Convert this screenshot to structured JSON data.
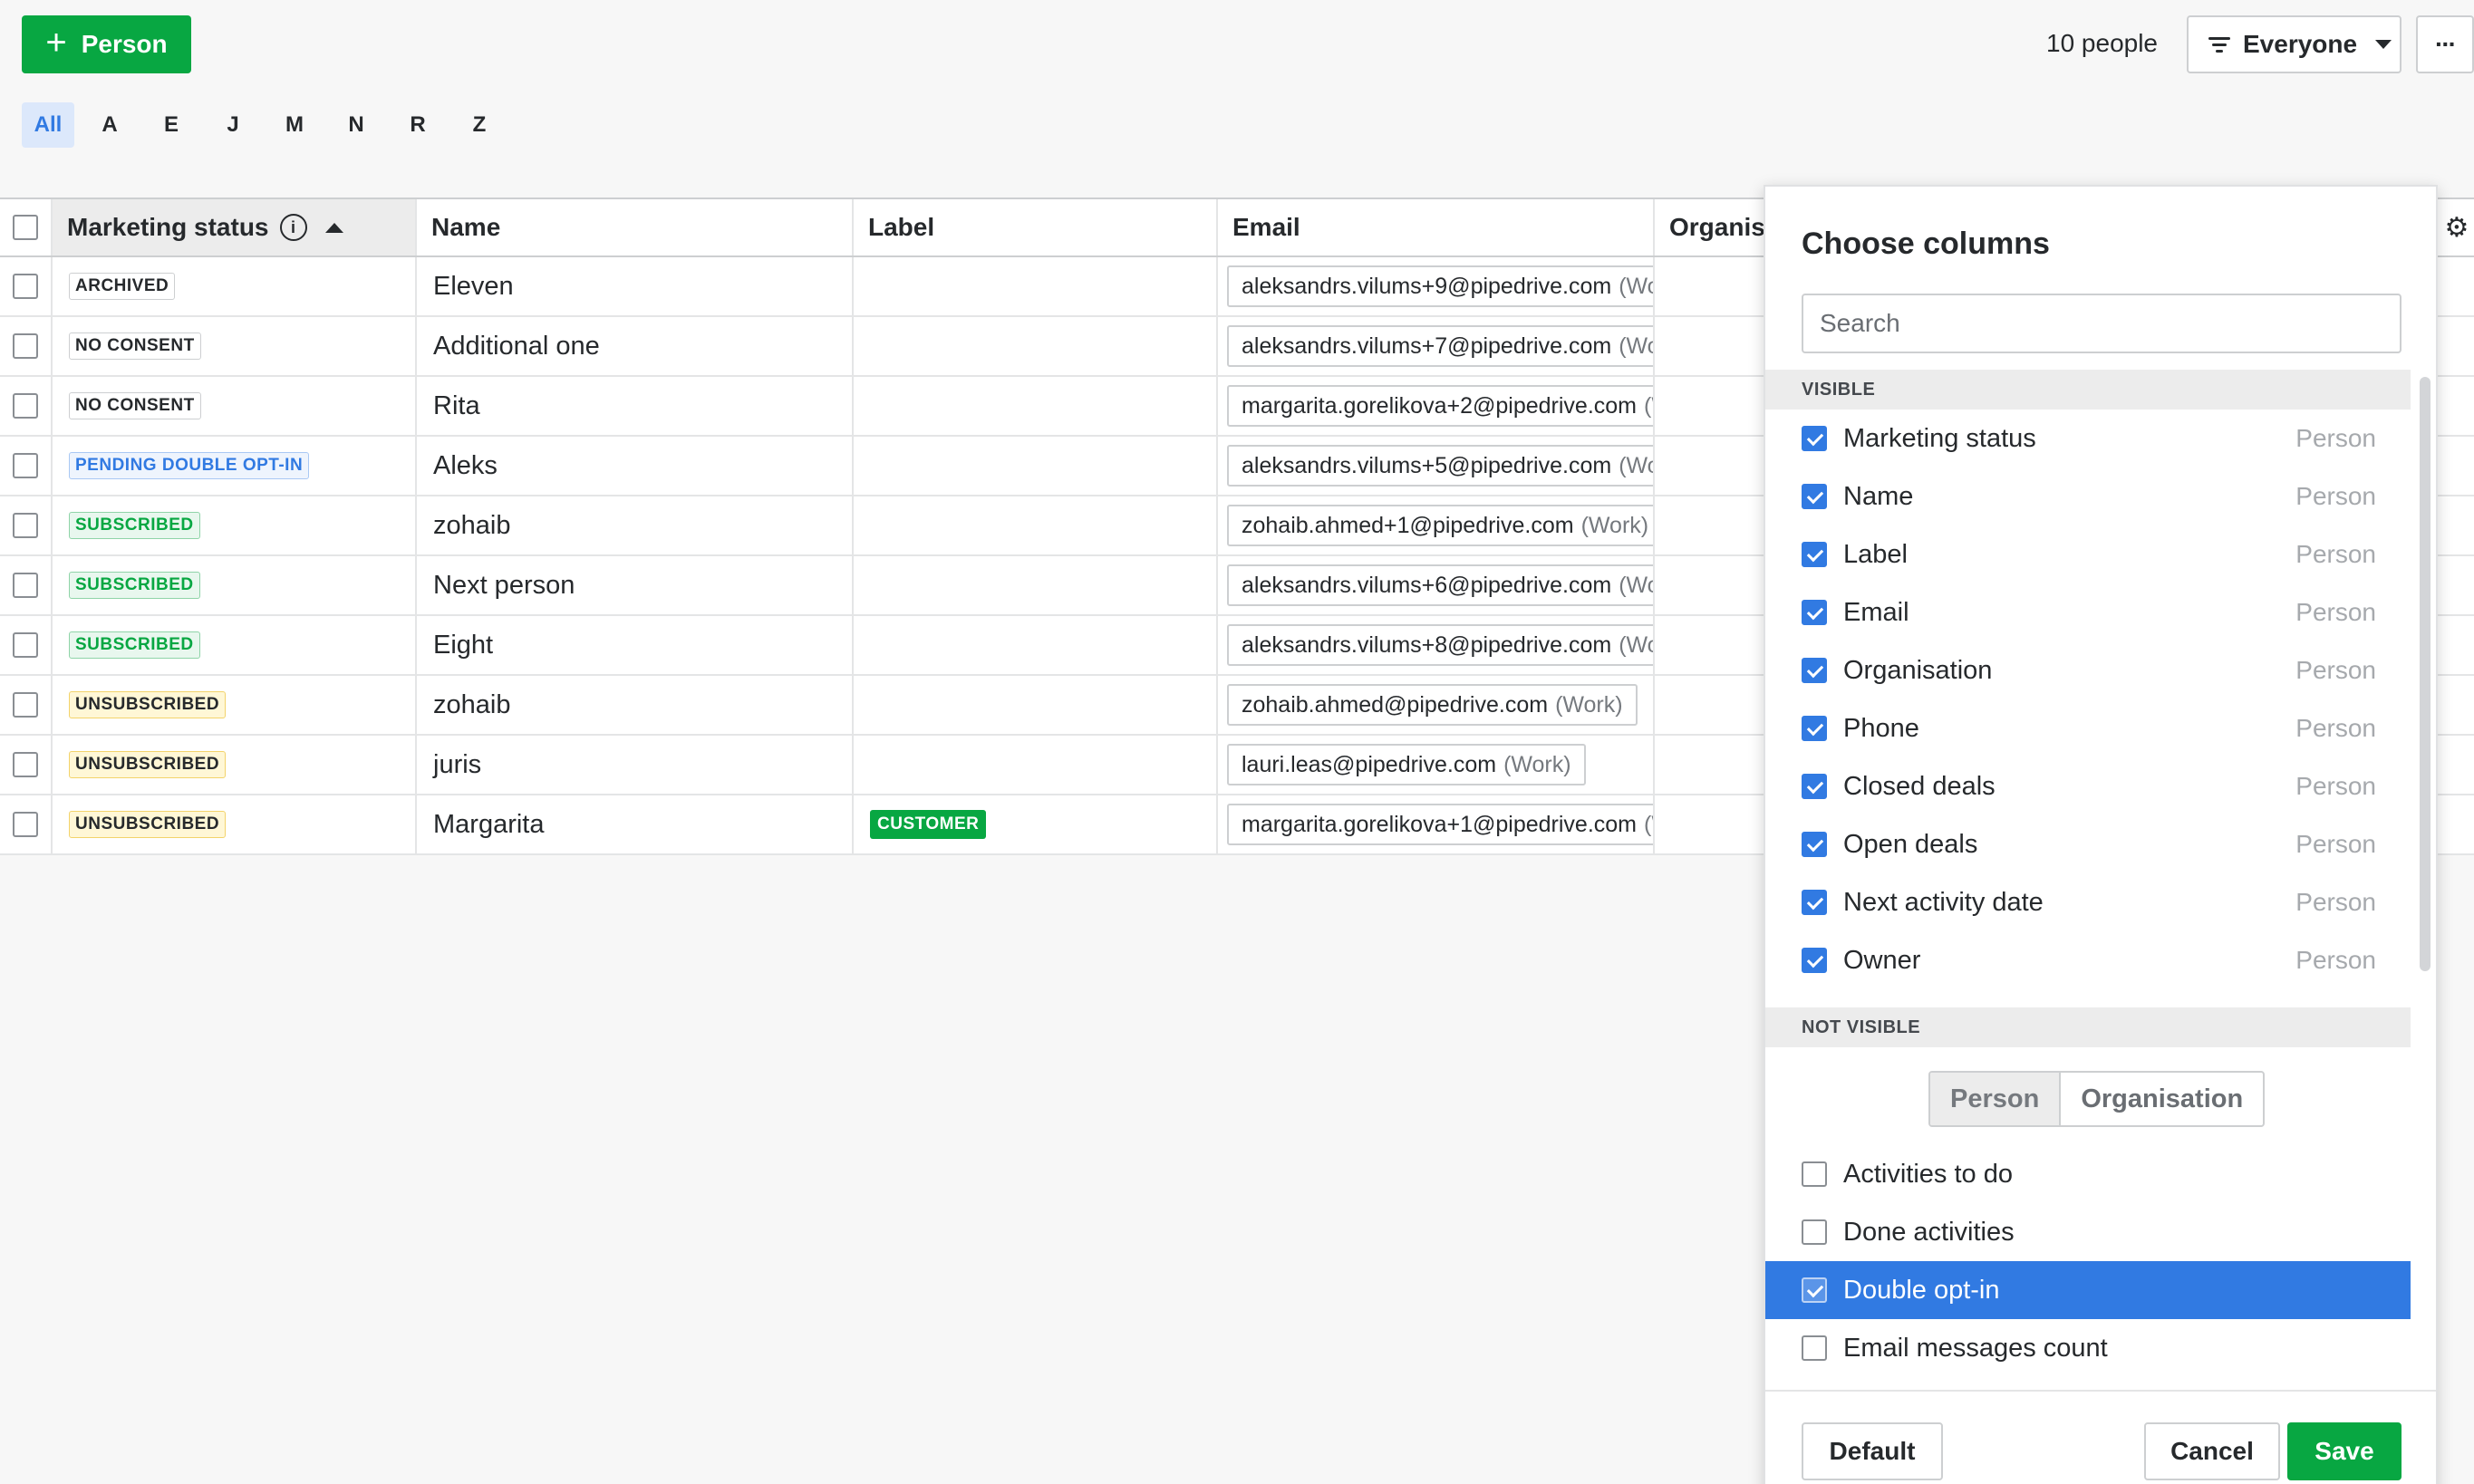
{
  "toolbar": {
    "add_label": "Person",
    "people_count": "10 people",
    "filter_label": "Everyone",
    "more_label": "···"
  },
  "alphabet": [
    "All",
    "A",
    "E",
    "J",
    "M",
    "N",
    "R",
    "Z"
  ],
  "table": {
    "headers": {
      "marketing_status": "Marketing status",
      "name": "Name",
      "label": "Label",
      "email": "Email",
      "organisation": "Organisa"
    },
    "rows": [
      {
        "status": "ARCHIVED",
        "status_type": "archived",
        "name": "Eleven",
        "label": "",
        "email": "aleksandrs.vilums+9@pipedrive.com",
        "email_type": "(Wor"
      },
      {
        "status": "NO CONSENT",
        "status_type": "noconsent",
        "name": "Additional one",
        "label": "",
        "email": "aleksandrs.vilums+7@pipedrive.com",
        "email_type": "(Wor"
      },
      {
        "status": "NO CONSENT",
        "status_type": "noconsent",
        "name": "Rita",
        "label": "",
        "email": "margarita.gorelikova+2@pipedrive.com",
        "email_type": "(W"
      },
      {
        "status": "PENDING DOUBLE OPT-IN",
        "status_type": "pending",
        "name": "Aleks",
        "label": "",
        "email": "aleksandrs.vilums+5@pipedrive.com",
        "email_type": "(Wor"
      },
      {
        "status": "SUBSCRIBED",
        "status_type": "subscribed",
        "name": "zohaib",
        "label": "",
        "email": "zohaib.ahmed+1@pipedrive.com",
        "email_type": "(Work)"
      },
      {
        "status": "SUBSCRIBED",
        "status_type": "subscribed",
        "name": "Next person",
        "label": "",
        "email": "aleksandrs.vilums+6@pipedrive.com",
        "email_type": "(Wor"
      },
      {
        "status": "SUBSCRIBED",
        "status_type": "subscribed",
        "name": "Eight",
        "label": "",
        "email": "aleksandrs.vilums+8@pipedrive.com",
        "email_type": "(Wor"
      },
      {
        "status": "UNSUBSCRIBED",
        "status_type": "unsubscribed",
        "name": "zohaib",
        "label": "",
        "email": "zohaib.ahmed@pipedrive.com",
        "email_type": "(Work)"
      },
      {
        "status": "UNSUBSCRIBED",
        "status_type": "unsubscribed",
        "name": "juris",
        "label": "",
        "email": "lauri.leas@pipedrive.com",
        "email_type": "(Work)"
      },
      {
        "status": "UNSUBSCRIBED",
        "status_type": "unsubscribed",
        "name": "Margarita",
        "label": "CUSTOMER",
        "email": "margarita.gorelikova+1@pipedrive.com",
        "email_type": "(W"
      }
    ]
  },
  "panel": {
    "title": "Choose columns",
    "search_placeholder": "Search",
    "visible_heading": "VISIBLE",
    "not_visible_heading": "NOT VISIBLE",
    "visible_columns": [
      {
        "label": "Marketing status",
        "source": "Person",
        "checked": true
      },
      {
        "label": "Name",
        "source": "Person",
        "checked": true
      },
      {
        "label": "Label",
        "source": "Person",
        "checked": true
      },
      {
        "label": "Email",
        "source": "Person",
        "checked": true
      },
      {
        "label": "Organisation",
        "source": "Person",
        "checked": true
      },
      {
        "label": "Phone",
        "source": "Person",
        "checked": true
      },
      {
        "label": "Closed deals",
        "source": "Person",
        "checked": true
      },
      {
        "label": "Open deals",
        "source": "Person",
        "checked": true
      },
      {
        "label": "Next activity date",
        "source": "Person",
        "checked": true
      },
      {
        "label": "Owner",
        "source": "Person",
        "checked": true
      }
    ],
    "segment": {
      "person": "Person",
      "organisation": "Organisation"
    },
    "not_visible_columns": [
      {
        "label": "Activities to do",
        "checked": false,
        "highlighted": false
      },
      {
        "label": "Done activities",
        "checked": false,
        "highlighted": false
      },
      {
        "label": "Double opt-in",
        "checked": true,
        "highlighted": true
      },
      {
        "label": "Email messages count",
        "checked": false,
        "highlighted": false
      }
    ],
    "buttons": {
      "default": "Default",
      "cancel": "Cancel",
      "save": "Save"
    }
  },
  "colors": {
    "primary_green": "#08a742",
    "accent_blue": "#317ae2",
    "highlight_blue": "#317ae2"
  }
}
